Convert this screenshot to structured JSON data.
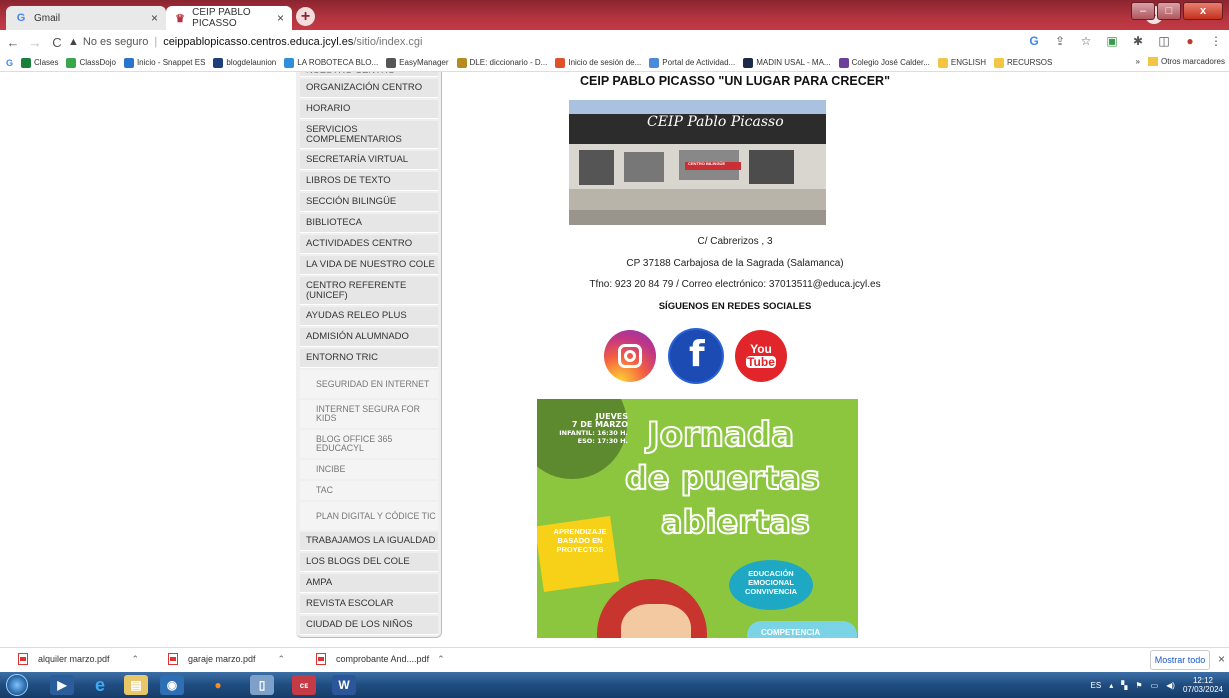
{
  "browser": {
    "tabs": [
      {
        "title": "Gmail",
        "favicon": "gmail-icon",
        "active": false
      },
      {
        "title": "CEIP PABLO PICASSO",
        "favicon": "school-icon",
        "active": true
      }
    ],
    "new_tab_label": "+",
    "address": {
      "security_label": "No es seguro",
      "host": "ceippablopicasso.centros.educa.jcyl.es",
      "path": "/sitio/index.cgi"
    },
    "bookmarks": [
      {
        "label": "Clases",
        "color": "#188038"
      },
      {
        "label": "ClassDojo",
        "color": "#3aa64c"
      },
      {
        "label": "Inicio - Snappet ES",
        "color": "#2a74d1"
      },
      {
        "label": "blogdelaunion",
        "color": "#1c3f7a"
      },
      {
        "label": "LA ROBOTECA BLO...",
        "color": "#2f8fd8"
      },
      {
        "label": "EasyManager",
        "color": "#555555"
      },
      {
        "label": "DLE: diccionario - D...",
        "color": "#b58a1f"
      },
      {
        "label": "Inicio de sesión de...",
        "color": "#e0502b"
      },
      {
        "label": "Portal de Actividad...",
        "color": "#4a8ad8"
      },
      {
        "label": "MADIN USAL - MA...",
        "color": "#1b2a4a"
      },
      {
        "label": "Colegio José Calder...",
        "color": "#6d3f9a"
      },
      {
        "label": "ENGLISH",
        "color": "#f4c542"
      },
      {
        "label": "RECURSOS",
        "color": "#f4c542"
      }
    ],
    "bookmarks_overflow": "»",
    "other_bookmarks": "Otros marcadores"
  },
  "sidebar": {
    "items": [
      {
        "label": "NUESTRO CENTRO"
      },
      {
        "label": "ORGANIZACIÓN CENTRO"
      },
      {
        "label": "HORARIO"
      },
      {
        "label": "SERVICIOS COMPLEMENTARIOS"
      },
      {
        "label": "SECRETARÍA VIRTUAL"
      },
      {
        "label": "LIBROS DE TEXTO"
      },
      {
        "label": "SECCIÓN BILINGÜE"
      },
      {
        "label": "BIBLIOTECA"
      },
      {
        "label": "ACTIVIDADES CENTRO"
      },
      {
        "label": "LA VIDA DE NUESTRO COLE"
      },
      {
        "label": "CENTRO REFERENTE (UNICEF)"
      },
      {
        "label": "AYUDAS RELEO PLUS"
      },
      {
        "label": "ADMISIÓN ALUMNADO"
      },
      {
        "label": "ENTORNO TRIC"
      }
    ],
    "subitems": [
      {
        "label": "SEGURIDAD EN INTERNET"
      },
      {
        "label": "INTERNET SEGURA FOR KIDS"
      },
      {
        "label": "BLOG OFFICE 365 EDUCACYL"
      },
      {
        "label": "INCIBE"
      },
      {
        "label": "TAC"
      },
      {
        "label": "PLAN DIGITAL Y CÓDICE TIC"
      }
    ],
    "items_after": [
      {
        "label": "TRABAJAMOS LA IGUALDAD"
      },
      {
        "label": "LOS BLOGS DEL COLE"
      },
      {
        "label": "AMPA"
      },
      {
        "label": "REVISTA ESCOLAR"
      },
      {
        "label": "CIUDAD DE LOS NIÑOS"
      }
    ]
  },
  "content": {
    "title": "CEIP PABLO PICASSO  \"UN LUGAR PARA CRECER\"",
    "photo_sign": "CEIP Pablo Picasso",
    "photo_banner": "CENTRO BILINGÜE",
    "address_line": "C/ Cabrerizos , 3",
    "postal_line": "CP 37188 Carbajosa de la Sagrada (Salamanca)",
    "contact_line": "Tfno: 923 20 84 79 / Correo electrónico: 37013511@educa.jcyl.es",
    "follow_label": "SÍGUENOS EN REDES SOCIALES",
    "social": [
      {
        "name": "instagram-icon",
        "color": "#d6307a"
      },
      {
        "name": "facebook-icon",
        "color": "#1b4bb3",
        "glyph": "f"
      },
      {
        "name": "youtube-icon",
        "color": "#e1252a",
        "glyph_top": "You",
        "glyph_bottom": "Tube"
      }
    ],
    "poster": {
      "date_line1": "JUEVES",
      "date_line2": "7 DE MARZO",
      "date_line3": "INFANTIL: 16:30 H.",
      "date_line4": "ESO: 17:30 H.",
      "headline1": "Jornada",
      "headline2": "de puertas",
      "headline3": "abiertas",
      "tag1": "APRENDIZAJE BASADO EN PROYECTOS",
      "tag2": "EDUCACIÓN EMOCIONAL CONVIVENCIA",
      "tag3": "COMPETENCIA"
    }
  },
  "downloads": {
    "items": [
      {
        "name": "alquiler marzo.pdf"
      },
      {
        "name": "garaje marzo.pdf"
      },
      {
        "name": "comprobante And....pdf"
      }
    ],
    "show_all": "Mostrar todo",
    "close": "×"
  },
  "taskbar": {
    "language": "ES",
    "time": "12:12",
    "date": "07/03/2024"
  }
}
